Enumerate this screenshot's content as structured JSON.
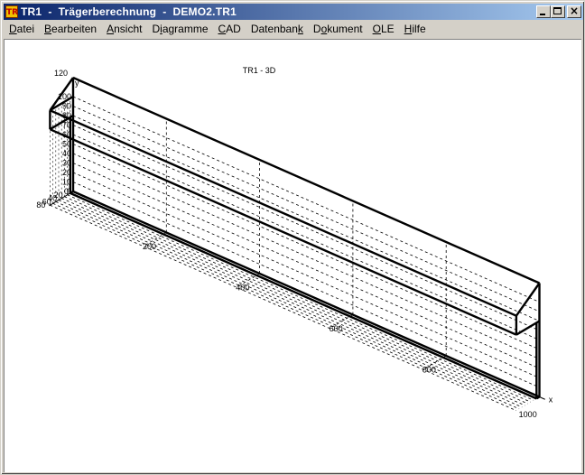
{
  "window": {
    "title": "TR1  -  Trägerberechnung  -  DEMO2.TR1",
    "icon_text": "TR",
    "icon_name": "tr1-app-icon"
  },
  "menu": [
    {
      "label": "Datei",
      "mnemonic": "D"
    },
    {
      "label": "Bearbeiten",
      "mnemonic": "B"
    },
    {
      "label": "Ansicht",
      "mnemonic": "A"
    },
    {
      "label": "Diagramme",
      "mnemonic": "i"
    },
    {
      "label": "CAD",
      "mnemonic": "C"
    },
    {
      "label": "Datenbank",
      "mnemonic": "k"
    },
    {
      "label": "Dokument",
      "mnemonic": "o"
    },
    {
      "label": "OLE",
      "mnemonic": "O"
    },
    {
      "label": "Hilfe",
      "mnemonic": "H"
    }
  ],
  "view": {
    "title": "TR1 - 3D",
    "x_axis_label": "x",
    "y_axis_label": "y",
    "x_ticks": [
      "200",
      "400",
      "600",
      "800",
      "1000"
    ],
    "y_ticks": [
      "0",
      "10",
      "20",
      "30",
      "40",
      "50",
      "60",
      "70",
      "80",
      "90",
      "100",
      "120"
    ],
    "z_ticks": [
      "0",
      "20",
      "40",
      "60",
      "80"
    ],
    "line_color": "#000000"
  }
}
